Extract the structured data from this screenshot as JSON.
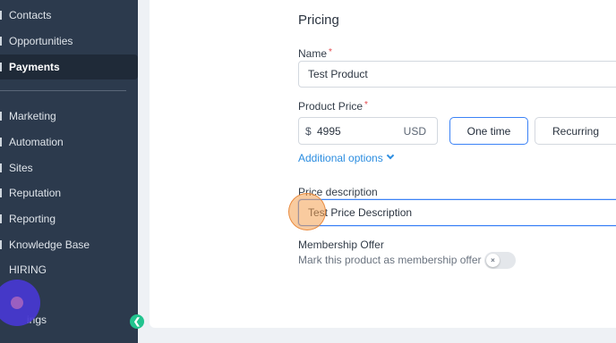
{
  "sidebar": {
    "items": [
      {
        "label": "Contacts",
        "icon": "contacts-icon",
        "active": false
      },
      {
        "label": "Opportunities",
        "icon": "opportunities-icon",
        "active": false
      },
      {
        "label": "Payments",
        "icon": "payments-icon",
        "active": true
      },
      {
        "label": "Marketing",
        "icon": "marketing-icon",
        "active": false
      },
      {
        "label": "Automation",
        "icon": "automation-icon",
        "active": false
      },
      {
        "label": "Sites",
        "icon": "sites-icon",
        "active": false
      },
      {
        "label": "Reputation",
        "icon": "reputation-icon",
        "active": false
      },
      {
        "label": "Reporting",
        "icon": "reporting-icon",
        "active": false
      },
      {
        "label": "Knowledge Base",
        "icon": "knowledge-base-icon",
        "active": false
      },
      {
        "label": "HIRING",
        "icon": "hiring-icon",
        "active": false
      },
      {
        "label": "ings",
        "icon": "settings-icon",
        "active": false
      }
    ],
    "collapse_icon": "chevron-left-icon",
    "accent_color": "#22c38e"
  },
  "form": {
    "section_title": "Pricing",
    "name": {
      "label": "Name",
      "required_mark": "*",
      "value": "Test Product"
    },
    "product_price": {
      "label": "Product Price",
      "required_mark": "*",
      "currency_symbol": "$",
      "value": "4995",
      "currency_code": "USD"
    },
    "price_type": {
      "options": [
        "One time",
        "Recurring"
      ],
      "selected": "One time"
    },
    "additional_options": "Additional options",
    "price_description": {
      "label": "Price description",
      "value": "Test Price Description"
    },
    "membership": {
      "title": "Membership Offer",
      "help": "Mark this product as membership offer",
      "toggle_on": false,
      "toggle_mark": "×"
    }
  },
  "colors": {
    "sidebar_bg": "#2c3a4d",
    "link": "#2b8de0",
    "focus": "#3b82f6"
  }
}
